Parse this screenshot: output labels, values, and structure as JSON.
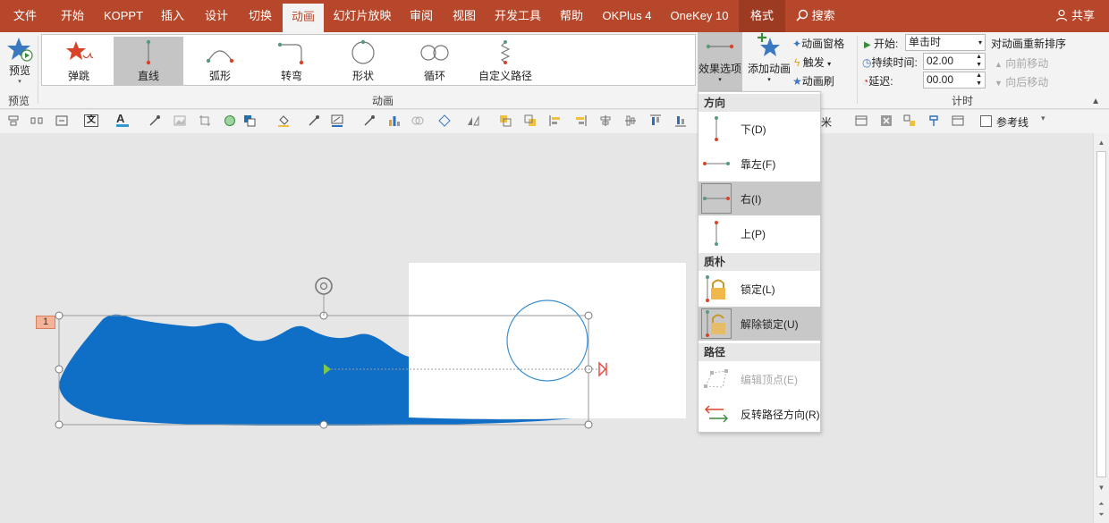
{
  "menu": {
    "tabs": [
      "文件",
      "开始",
      "KOPPT",
      "插入",
      "设计",
      "切换",
      "动画",
      "幻灯片放映",
      "审阅",
      "视图",
      "开发工具",
      "帮助",
      "OKPlus 4",
      "OneKey 10",
      "格式"
    ],
    "search": "搜索",
    "share": "共享"
  },
  "ribbon": {
    "preview": {
      "label": "预览",
      "group": "预览"
    },
    "gallery": {
      "group": "动画",
      "items": [
        "弹跳",
        "直线",
        "弧形",
        "转弯",
        "形状",
        "循环",
        "自定义路径"
      ]
    },
    "effect_options": "效果选项",
    "add_animation": "添加动画",
    "animation_pane": "动画窗格",
    "trigger": "触发",
    "animation_painter": "动画刷",
    "timing": {
      "group": "计时",
      "start_label": "开始:",
      "start_value": "单击时",
      "duration_label": "持续时间:",
      "duration_value": "02.00",
      "delay_label": "延迟:",
      "delay_value": "00.00",
      "reorder": "对动画重新排序",
      "move_earlier": "向前移动",
      "move_later": "向后移动"
    }
  },
  "quick": {
    "unit_text": "米",
    "guides": "参考线"
  },
  "slide": {
    "anim_number": "1"
  },
  "dropdown": {
    "sections": [
      {
        "title": "方向",
        "items": [
          "下(D)",
          "靠左(F)",
          "右(I)",
          "上(P)"
        ]
      },
      {
        "title": "质朴",
        "items": [
          "锁定(L)",
          "解除锁定(U)"
        ]
      },
      {
        "title": "路径",
        "items": [
          "编辑顶点(E)",
          "反转路径方向(R)"
        ]
      }
    ]
  },
  "colors": {
    "accent": "#b7472a",
    "shape": "#0f6fc6",
    "path_green": "#5a9a7a",
    "path_red": "#d9432a"
  }
}
